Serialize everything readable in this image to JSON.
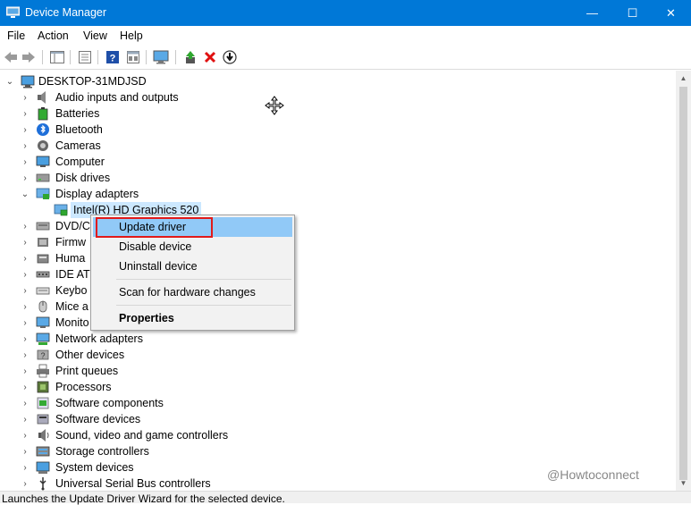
{
  "window": {
    "title": "Device Manager",
    "minimize_glyph": "—",
    "maximize_glyph": "☐",
    "close_glyph": "✕"
  },
  "menu": [
    "File",
    "Action",
    "View",
    "Help"
  ],
  "toolbar_icons": [
    "back-arrow-icon",
    "forward-arrow-icon",
    "console-tree-icon",
    "properties-icon",
    "help-icon",
    "device-view-icon",
    "monitor-icon",
    "update-driver-icon",
    "uninstall-x-icon",
    "download-icon"
  ],
  "tree": {
    "root": {
      "label": "DESKTOP-31MDJSD",
      "expander": "⌄"
    },
    "categories": [
      {
        "label": "Audio inputs and outputs",
        "icon": "speaker-icon",
        "expander": "›"
      },
      {
        "label": "Batteries",
        "icon": "battery-icon",
        "expander": "›"
      },
      {
        "label": "Bluetooth",
        "icon": "bluetooth-icon",
        "expander": "›"
      },
      {
        "label": "Cameras",
        "icon": "camera-icon",
        "expander": "›"
      },
      {
        "label": "Computer",
        "icon": "computer-icon",
        "expander": "›"
      },
      {
        "label": "Disk drives",
        "icon": "disk-drive-icon",
        "expander": "›"
      },
      {
        "label": "Display adapters",
        "icon": "display-adapter-icon",
        "expander": "⌄"
      },
      {
        "label": "DVD/C",
        "icon": "dvd-icon",
        "expander": "›"
      },
      {
        "label": "Firmw",
        "icon": "firmware-icon",
        "expander": "›"
      },
      {
        "label": "Huma",
        "icon": "hid-icon",
        "expander": "›"
      },
      {
        "label": "IDE AT",
        "icon": "ide-icon",
        "expander": "›"
      },
      {
        "label": "Keybo",
        "icon": "keyboard-icon",
        "expander": "›"
      },
      {
        "label": "Mice a",
        "icon": "mouse-icon",
        "expander": "›"
      },
      {
        "label": "Monito",
        "icon": "monitor-icon",
        "expander": "›"
      },
      {
        "label": "Network adapters",
        "icon": "network-icon",
        "expander": "›"
      },
      {
        "label": "Other devices",
        "icon": "other-devices-icon",
        "expander": "›"
      },
      {
        "label": "Print queues",
        "icon": "printer-icon",
        "expander": "›"
      },
      {
        "label": "Processors",
        "icon": "processor-icon",
        "expander": "›"
      },
      {
        "label": "Software components",
        "icon": "software-component-icon",
        "expander": "›"
      },
      {
        "label": "Software devices",
        "icon": "software-device-icon",
        "expander": "›"
      },
      {
        "label": "Sound, video and game controllers",
        "icon": "sound-icon",
        "expander": "›"
      },
      {
        "label": "Storage controllers",
        "icon": "storage-icon",
        "expander": "›"
      },
      {
        "label": "System devices",
        "icon": "system-devices-icon",
        "expander": "›"
      },
      {
        "label": "Universal Serial Bus controllers",
        "icon": "usb-icon",
        "expander": "›"
      }
    ],
    "selected_child": {
      "label": "Intel(R) HD Graphics 520",
      "icon": "display-adapter-icon"
    }
  },
  "context_menu": {
    "items": [
      {
        "label": "Update driver",
        "highlighted": true,
        "bold": false
      },
      {
        "label": "Disable device",
        "highlighted": false,
        "bold": false
      },
      {
        "label": "Uninstall device",
        "highlighted": false,
        "bold": false
      },
      {
        "label": "Scan for hardware changes",
        "highlighted": false,
        "bold": false
      },
      {
        "label": "Properties",
        "highlighted": false,
        "bold": true
      }
    ]
  },
  "status": "Launches the Update Driver Wizard for the selected device.",
  "watermark": "@Howtoconnect",
  "colors": {
    "titlebar": "#0078d7",
    "highlight": "#91c9f7",
    "selection": "#cce8ff",
    "annotation_red": "#e11a1a"
  }
}
